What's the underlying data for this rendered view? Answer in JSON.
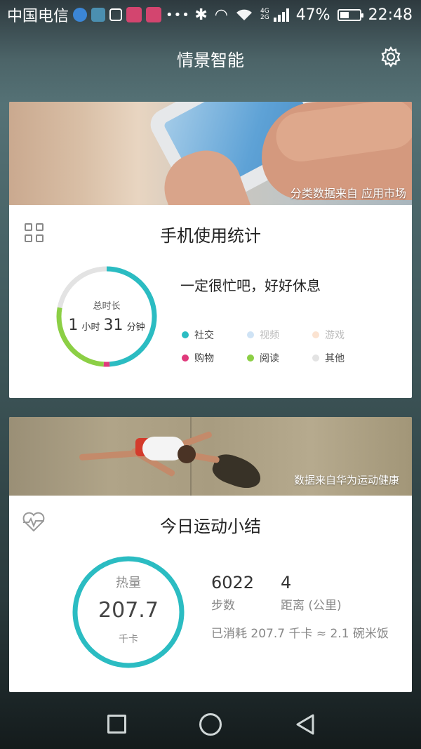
{
  "statusbar": {
    "carrier": "中国电信",
    "network_top": "4G",
    "network_bottom": "2G",
    "battery": "47%",
    "time": "22:48",
    "battery_level": 0.47
  },
  "header": {
    "title": "情景智能",
    "settings_icon": "gear-icon"
  },
  "usage_card": {
    "banner_caption": "分类数据来自 应用市场",
    "title": "手机使用统计",
    "icon": "grid-icon",
    "ring_label": "总时长",
    "hours": "1",
    "hours_unit": "小时",
    "minutes": "31",
    "minutes_unit": "分钟",
    "message": "一定很忙吧，好好休息",
    "legend": [
      {
        "label": "社交",
        "color": "#2bbcc2"
      },
      {
        "label": "视频",
        "color": "#cfe3f5"
      },
      {
        "label": "游戏",
        "color": "#fbe3d1"
      },
      {
        "label": "购物",
        "color": "#e03a7c"
      },
      {
        "label": "阅读",
        "color": "#8ccf45"
      },
      {
        "label": "其他",
        "color": "#e3e3e3"
      }
    ],
    "ring_shares": {
      "social": 0.49,
      "shopping": 0.02,
      "reading": 0.27,
      "other": 0.22
    }
  },
  "sport_card": {
    "banner_caption": "数据来自华为运动健康",
    "title": "今日运动小结",
    "icon": "heart-pulse-icon",
    "calorie_label": "热量",
    "calorie_value": "207.7",
    "calorie_unit": "千卡",
    "steps_value": "6022",
    "steps_label": "步数",
    "distance_value": "4",
    "distance_label": "距离 (公里)",
    "consume_text": "已消耗 207.7 千卡 ≈ 2.1 碗米饭",
    "ring_color": "#2bbcc2"
  },
  "navbar": {
    "recent_icon": "square-icon",
    "home_icon": "circle-icon",
    "back_icon": "triangle-back-icon"
  }
}
